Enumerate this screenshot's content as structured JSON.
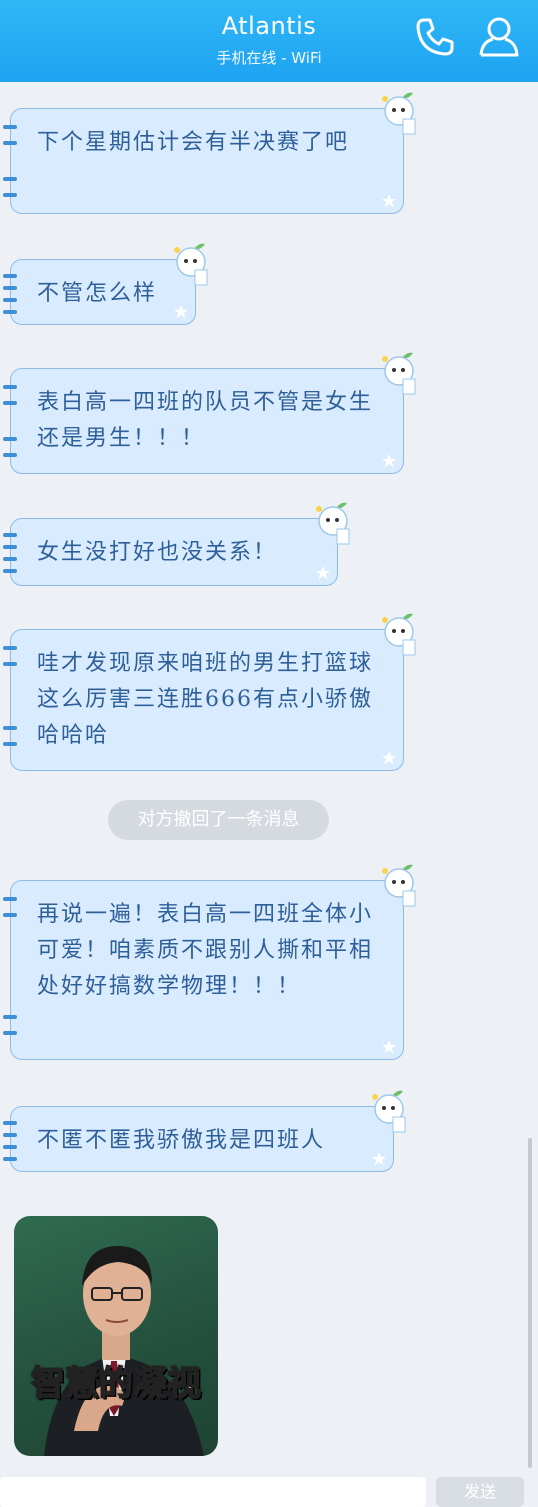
{
  "header": {
    "title": "Atlantis",
    "status": "手机在线 - WiFi",
    "call_icon": "phone-icon",
    "profile_icon": "user-icon"
  },
  "messages": [
    {
      "text": "下个星期估计会有半决赛了吧"
    },
    {
      "text": "不管怎么样"
    },
    {
      "text": "表白高一四班的队员不管是女生还是男生！！！"
    },
    {
      "text": "女生没打好也没关系！"
    },
    {
      "text": "哇才发现原来咱班的男生打篮球这么厉害三连胜666有点小骄傲哈哈哈"
    },
    {
      "text": "再说一遍！表白高一四班全体小可爱！咱素质不跟别人撕和平相处好好搞数学物理！！！"
    },
    {
      "text": "不匿不匿我骄傲我是四班人"
    }
  ],
  "system_notice": "对方撤回了一条消息",
  "sticker": {
    "caption": "智慧的凝视"
  },
  "input": {
    "send_label": "发送"
  },
  "colors": {
    "header": "#1ea3f1",
    "bubble_bg": "#d9ebff",
    "bubble_border": "#8ebbe5",
    "bubble_text": "#2f5f98"
  }
}
